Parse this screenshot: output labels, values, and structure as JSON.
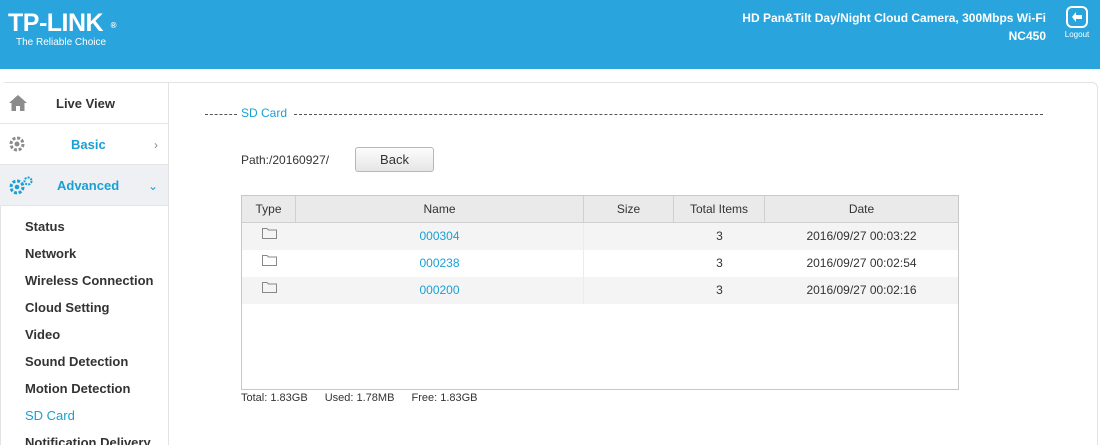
{
  "header": {
    "brand": "TP-LINK",
    "registered": "®",
    "tagline": "The Reliable Choice",
    "model_line1": "HD Pan&Tilt Day/Night Cloud Camera, 300Mbps Wi-Fi",
    "model_line2": "NC450",
    "logout_label": "Logout"
  },
  "sidebar": {
    "live_view": "Live View",
    "basic": "Basic",
    "advanced": "Advanced",
    "items": [
      {
        "label": "Status"
      },
      {
        "label": "Network"
      },
      {
        "label": "Wireless Connection"
      },
      {
        "label": "Cloud Setting"
      },
      {
        "label": "Video"
      },
      {
        "label": "Sound Detection"
      },
      {
        "label": "Motion Detection"
      },
      {
        "label": "SD Card"
      },
      {
        "label": "Notification Delivery"
      }
    ]
  },
  "main": {
    "section_title": "SD Card",
    "path": "Path:/20160927/",
    "back_label": "Back",
    "columns": [
      "Type",
      "Name",
      "Size",
      "Total Items",
      "Date"
    ],
    "rows": [
      {
        "name": "000304",
        "size": "",
        "total": "3",
        "date": "2016/09/27 00:03:22"
      },
      {
        "name": "000238",
        "size": "",
        "total": "3",
        "date": "2016/09/27 00:02:54"
      },
      {
        "name": "000200",
        "size": "",
        "total": "3",
        "date": "2016/09/27 00:02:16"
      }
    ],
    "total": "Total: 1.83GB",
    "used": "Used: 1.78MB",
    "free": "Free: 1.83GB"
  },
  "colors": {
    "header_bg": "#2aa4dc",
    "accent": "#1a9fd5"
  }
}
